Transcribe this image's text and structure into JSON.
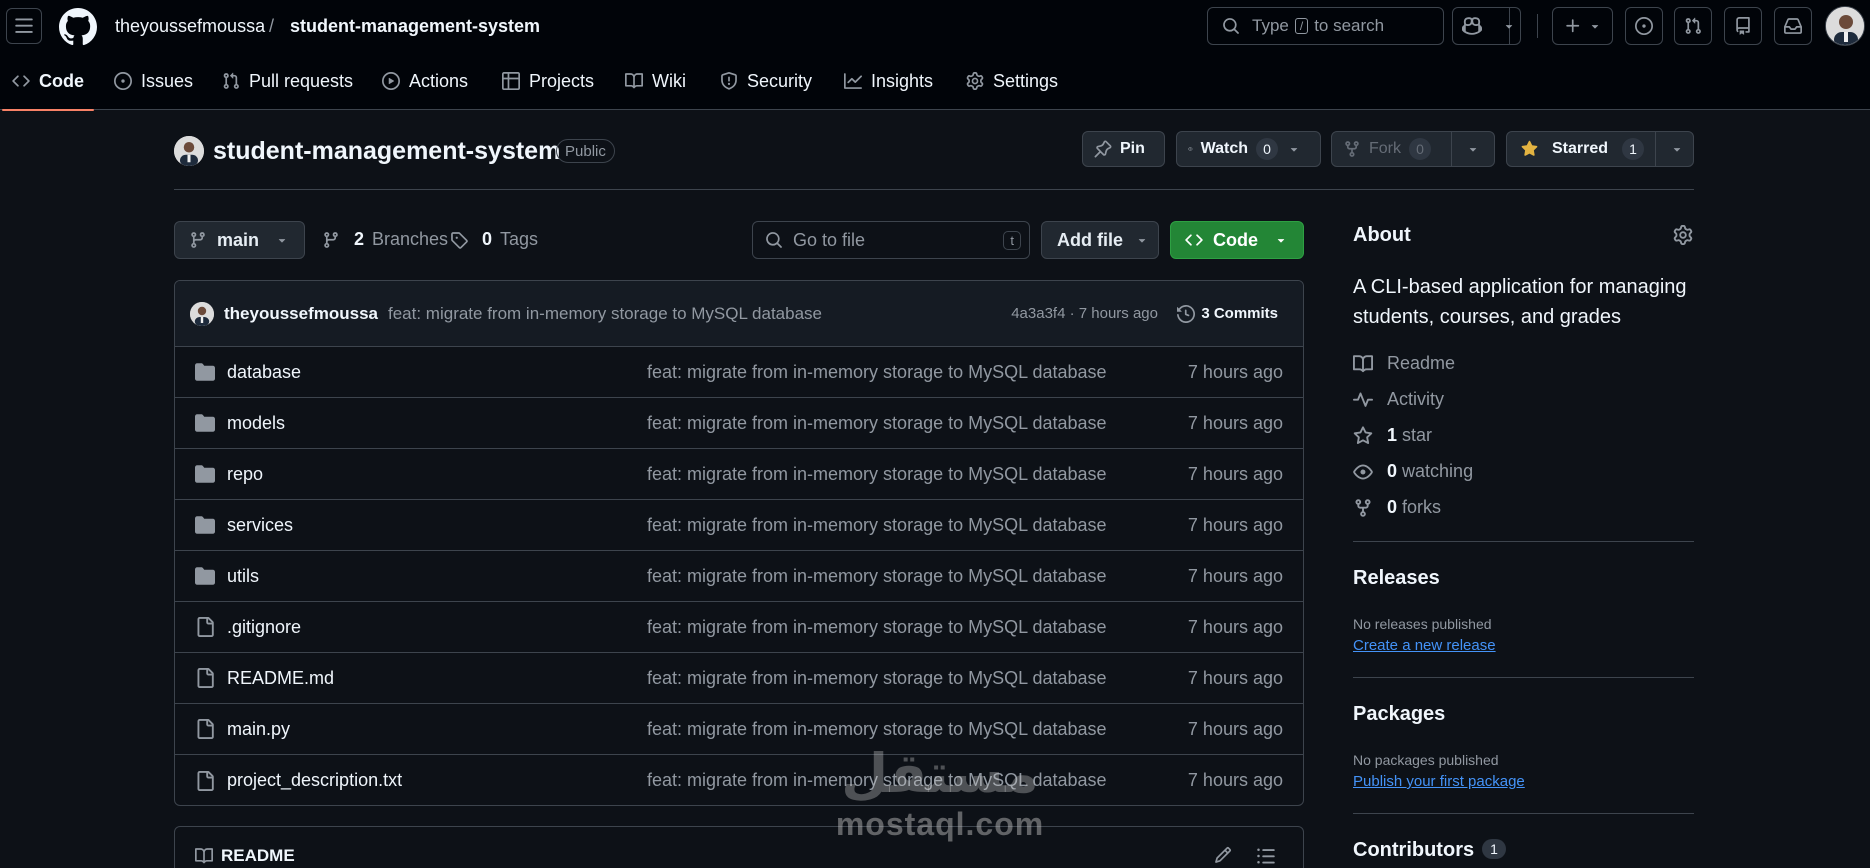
{
  "header": {
    "owner": "theyoussefmoussa",
    "separator": "/",
    "repo": "student-management-system",
    "search_prefix": "Type",
    "search_key": "/",
    "search_suffix": "to search"
  },
  "nav": {
    "tabs": [
      {
        "label": "Code",
        "icon": "code-icon"
      },
      {
        "label": "Issues",
        "icon": "issue-icon"
      },
      {
        "label": "Pull requests",
        "icon": "pull-request-icon"
      },
      {
        "label": "Actions",
        "icon": "play-icon"
      },
      {
        "label": "Projects",
        "icon": "table-icon"
      },
      {
        "label": "Wiki",
        "icon": "book-icon"
      },
      {
        "label": "Security",
        "icon": "shield-icon"
      },
      {
        "label": "Insights",
        "icon": "graph-icon"
      },
      {
        "label": "Settings",
        "icon": "gear-icon"
      }
    ]
  },
  "repo": {
    "title": "student-management-system",
    "visibility": "Public",
    "pin_label": "Pin",
    "watch_label": "Watch",
    "watch_count": "0",
    "fork_label": "Fork",
    "fork_count": "0",
    "star_label": "Starred",
    "star_count": "1"
  },
  "toolbar": {
    "branch": "main",
    "branches_count": "2",
    "branches_label": "Branches",
    "tags_count": "0",
    "tags_label": "Tags",
    "goto_placeholder": "Go to file",
    "goto_key": "t",
    "add_file_label": "Add file",
    "code_label": "Code"
  },
  "latest_commit": {
    "author": "theyoussefmoussa",
    "message": "feat: migrate from in-memory storage to MySQL database",
    "sha_time": "4a3a3f4 · 7 hours ago",
    "commits_label": "3 Commits"
  },
  "files": [
    {
      "name": "database",
      "type": "folder",
      "message": "feat: migrate from in-memory storage to MySQL database",
      "time": "7 hours ago"
    },
    {
      "name": "models",
      "type": "folder",
      "message": "feat: migrate from in-memory storage to MySQL database",
      "time": "7 hours ago"
    },
    {
      "name": "repo",
      "type": "folder",
      "message": "feat: migrate from in-memory storage to MySQL database",
      "time": "7 hours ago"
    },
    {
      "name": "services",
      "type": "folder",
      "message": "feat: migrate from in-memory storage to MySQL database",
      "time": "7 hours ago"
    },
    {
      "name": "utils",
      "type": "folder",
      "message": "feat: migrate from in-memory storage to MySQL database",
      "time": "7 hours ago"
    },
    {
      "name": ".gitignore",
      "type": "file",
      "message": "feat: migrate from in-memory storage to MySQL database",
      "time": "7 hours ago"
    },
    {
      "name": "README.md",
      "type": "file",
      "message": "feat: migrate from in-memory storage to MySQL database",
      "time": "7 hours ago"
    },
    {
      "name": "main.py",
      "type": "file",
      "message": "feat: migrate from in-memory storage to MySQL database",
      "time": "7 hours ago"
    },
    {
      "name": "project_description.txt",
      "type": "file",
      "message": "feat: migrate from in-memory storage to MySQL database",
      "time": "7 hours ago"
    }
  ],
  "readme": {
    "label": "README"
  },
  "about": {
    "heading": "About",
    "description": "A CLI-based application for managing students, courses, and grades",
    "readme": "Readme",
    "activity": "Activity",
    "stars_count": "1",
    "stars_label": "star",
    "watching_count": "0",
    "watching_label": "watching",
    "forks_count": "0",
    "forks_label": "forks"
  },
  "releases": {
    "heading": "Releases",
    "empty": "No releases published",
    "link": "Create a new release"
  },
  "packages": {
    "heading": "Packages",
    "empty": "No packages published",
    "link": "Publish your first package"
  },
  "contributors": {
    "heading": "Contributors",
    "count": "1"
  },
  "watermark": {
    "arabic": "مستقل",
    "latin": "mostaql.com"
  }
}
